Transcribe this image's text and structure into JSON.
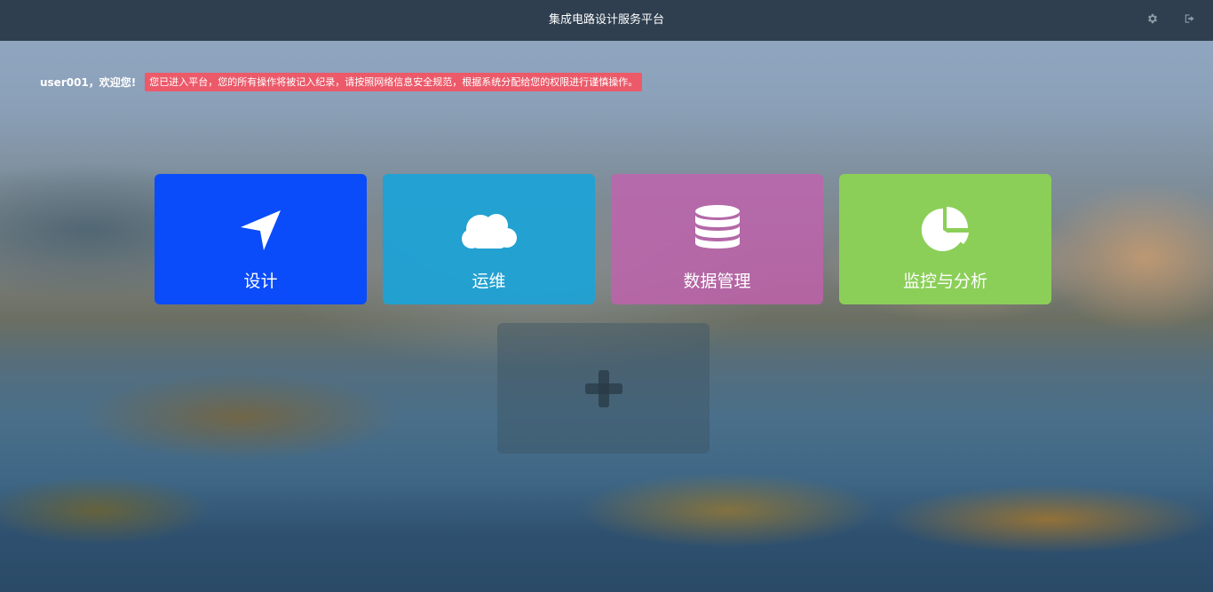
{
  "header": {
    "title": "集成电路设计服务平台",
    "settings_icon": "gear-icon",
    "logout_icon": "sign-out-icon"
  },
  "welcome": {
    "greeting": "user001，欢迎您!",
    "notice": "您已进入平台，您的所有操作将被记入纪录，请按照网络信息安全规范，根据系统分配给您的权限进行谨慎操作。"
  },
  "tiles": [
    {
      "label": "设计",
      "icon": "location-arrow-icon",
      "color": "#0a4cf9"
    },
    {
      "label": "运维",
      "icon": "cloud-icon",
      "color": "#1ba3d7"
    },
    {
      "label": "数据管理",
      "icon": "database-icon",
      "color": "#c460af"
    },
    {
      "label": "监控与分析",
      "icon": "pie-chart-icon",
      "color": "#8bcf59"
    }
  ],
  "add_tile": {
    "icon": "plus-icon"
  },
  "colors": {
    "topbar": "#2f3f50",
    "notice": "#ec5a6a"
  }
}
